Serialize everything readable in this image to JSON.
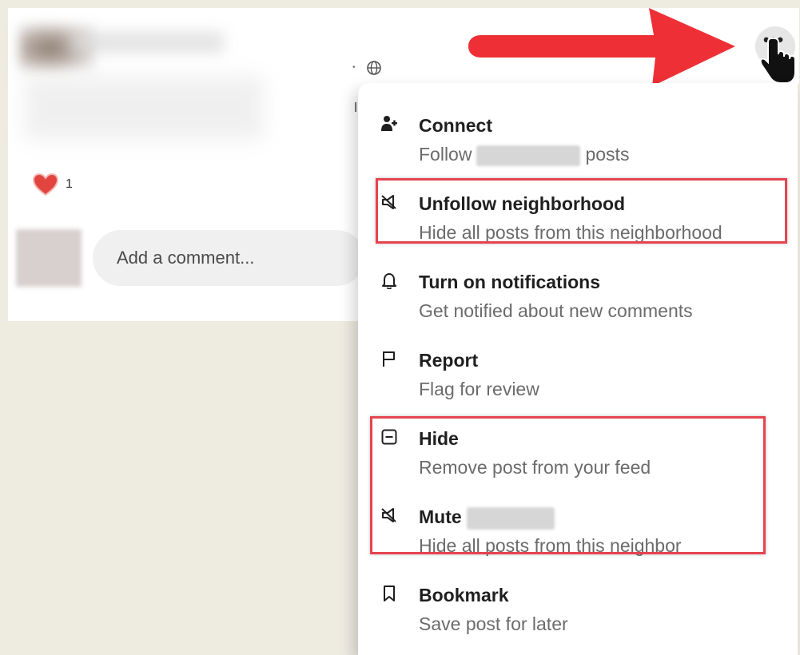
{
  "post": {
    "reaction_count": "1",
    "comment_placeholder": "Add a comment..."
  },
  "menu": {
    "connect": {
      "title": "Connect",
      "sub_prefix": "Follow",
      "sub_suffix": "posts",
      "icon": "person-plus-icon"
    },
    "unfollow": {
      "title": "Unfollow neighborhood",
      "sub": "Hide all posts from this neighborhood",
      "icon": "megaphone-mute-icon"
    },
    "notifications": {
      "title": "Turn on notifications",
      "sub": "Get notified about new comments",
      "icon": "bell-icon"
    },
    "report": {
      "title": "Report",
      "sub": "Flag for review",
      "icon": "flag-icon"
    },
    "hide": {
      "title": "Hide",
      "sub": "Remove post from your feed",
      "icon": "minus-square-icon"
    },
    "mute": {
      "title": "Mute",
      "sub": "Hide all posts from this neighbor",
      "icon": "megaphone-mute-icon"
    },
    "bookmark": {
      "title": "Bookmark",
      "sub": "Save post for later",
      "icon": "bookmark-icon"
    }
  },
  "colors": {
    "highlight": "#e64450",
    "arrow": "#ee2f36",
    "background": "#eeebe1"
  }
}
